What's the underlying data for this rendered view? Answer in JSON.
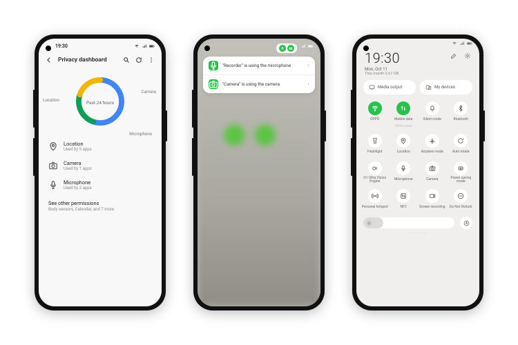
{
  "phone1": {
    "statusbar": {
      "time": "19:30"
    },
    "header": {
      "title": "Privacy dashboard"
    },
    "donut": {
      "center": "Past 24 hours",
      "labels": {
        "location": "Location",
        "camera": "Camera",
        "microphone": "Microphone"
      },
      "segments": {
        "location_pct": 55,
        "camera_pct": 25,
        "microphone_pct": 20
      },
      "colors": {
        "location": "#4285F4",
        "camera": "#0F9D58",
        "microphone": "#F4B400"
      }
    },
    "perms": [
      {
        "icon": "map-pin-icon",
        "title": "Location",
        "sub": "Used by 5 apps"
      },
      {
        "icon": "camera-icon",
        "title": "Camera",
        "sub": "Used by 1 apps"
      },
      {
        "icon": "microphone-icon",
        "title": "Microphone",
        "sub": "Used by 2 apps"
      }
    ],
    "see_other": {
      "title": "See other permissions",
      "sub": "Body sensors, Calendar, and 7 more"
    }
  },
  "phone2": {
    "pill": {
      "mic_color": "#27c24c",
      "cam_color": "#27c24c"
    },
    "notifs": [
      {
        "icon": "microphone-icon",
        "icon_bg": "#27c24c",
        "text": "\"Recorder\" is using the microphone"
      },
      {
        "icon": "camera-icon",
        "icon_bg": "#27c24c",
        "text": "\"Camera\" is using the camera"
      }
    ]
  },
  "phone3": {
    "clock": {
      "time": "19:30",
      "date": "Mon, Oct 11",
      "sub": "This month 2.67 GB"
    },
    "cards": {
      "media": "Media output",
      "devices": "My devices"
    },
    "tiles": [
      {
        "icon": "wifi-icon",
        "label": "OPPO",
        "sub": "",
        "active": true
      },
      {
        "icon": "mobile-data-icon",
        "label": "Mobile data",
        "sub": "OPPO mobile",
        "active": true
      },
      {
        "icon": "bell-icon",
        "label": "Silent mode",
        "sub": "",
        "active": false
      },
      {
        "icon": "bluetooth-icon",
        "label": "Bluetooth",
        "sub": "",
        "active": false
      },
      {
        "icon": "flashlight-icon",
        "label": "Flashlight",
        "sub": "",
        "active": false
      },
      {
        "icon": "map-pin-icon",
        "label": "Location",
        "sub": "",
        "active": false
      },
      {
        "icon": "airplane-icon",
        "label": "Airplane mode",
        "sub": "",
        "active": false
      },
      {
        "icon": "rotate-icon",
        "label": "Auto rotate",
        "sub": "",
        "active": false
      },
      {
        "icon": "o1-icon",
        "label": "O1 Ultra Vision Engine",
        "sub": "",
        "active": false
      },
      {
        "icon": "microphone-icon",
        "label": "Microphone",
        "sub": "",
        "active": false
      },
      {
        "icon": "camera-icon",
        "label": "Camera",
        "sub": "",
        "active": false
      },
      {
        "icon": "battery-icon",
        "label": "Power saving mode",
        "sub": "",
        "active": false
      },
      {
        "icon": "hotspot-icon",
        "label": "Personal hotspot",
        "sub": "",
        "active": false
      },
      {
        "icon": "nfc-icon",
        "label": "NFC",
        "sub": "",
        "active": false
      },
      {
        "icon": "record-icon",
        "label": "Screen recording",
        "sub": "",
        "active": false
      },
      {
        "icon": "dnd-icon",
        "label": "Do Not Disturb",
        "sub": "",
        "active": false
      }
    ],
    "brightness": {
      "value_pct": 22
    },
    "footer": {
      "label": "· · · · · · · · ·"
    }
  },
  "chart_data": {
    "type": "pie",
    "title": "Past 24 hours",
    "series": [
      {
        "name": "Location",
        "value": 55,
        "color": "#4285F4"
      },
      {
        "name": "Camera",
        "value": 25,
        "color": "#0F9D58"
      },
      {
        "name": "Microphone",
        "value": 20,
        "color": "#F4B400"
      }
    ]
  }
}
